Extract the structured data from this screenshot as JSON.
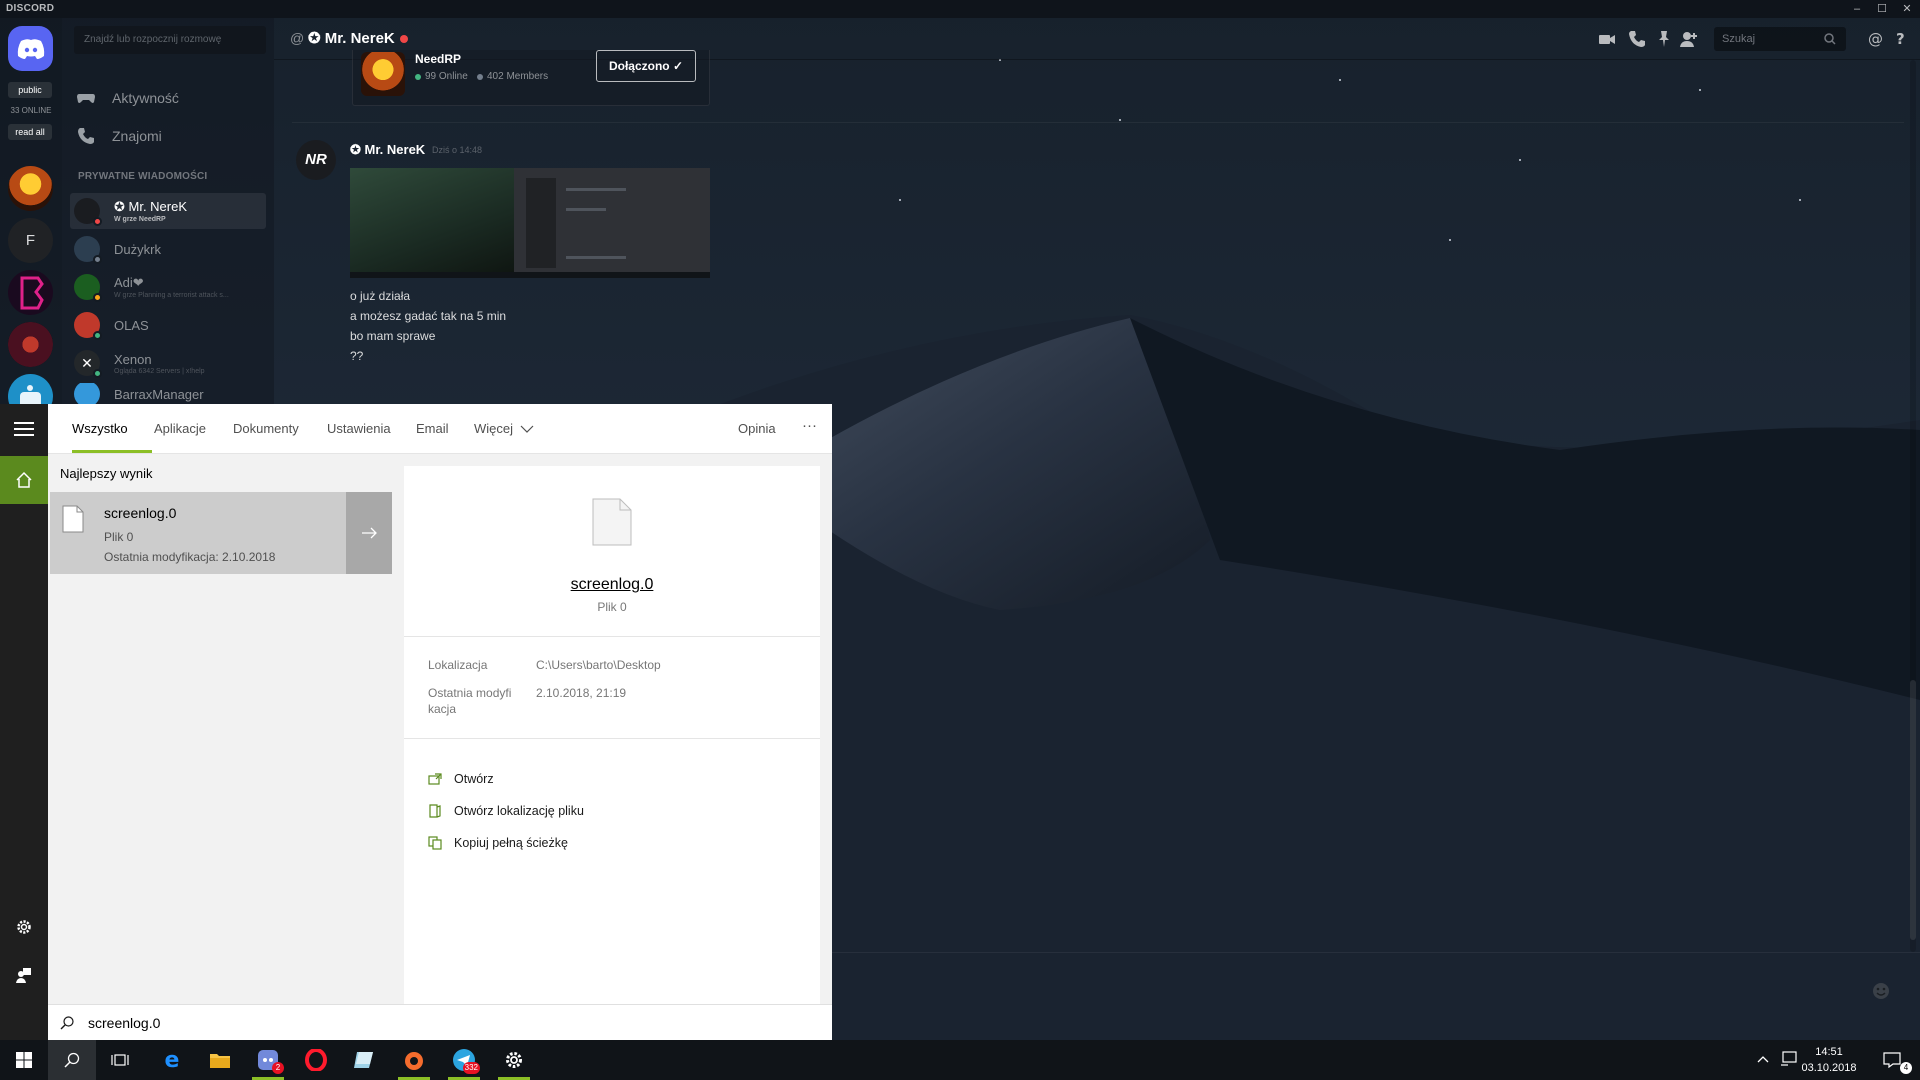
{
  "window": {
    "brand": "DISCORD",
    "controls": [
      "–",
      "☐",
      "✕"
    ]
  },
  "guilds": {
    "public_label": "public",
    "online_count": "33 ONLINE",
    "read_all": "read all",
    "server_letter": "F"
  },
  "dm_panel": {
    "search_placeholder": "Znajdź lub rozpocznij rozmowę",
    "nav": [
      {
        "label": "Aktywność",
        "icon": "gamepad-icon"
      },
      {
        "label": "Znajomi",
        "icon": "friends-icon"
      }
    ],
    "section_header": "PRYWATNE WIADOMOŚCI",
    "dms": [
      {
        "name": "✪ Mr. NereK",
        "sub": "W grze NeedRP",
        "status": "dnd"
      },
      {
        "name": "Dużykrk",
        "sub": "",
        "status": "offline"
      },
      {
        "name": "Adi❤",
        "sub": "W grze Planning a terrorist attack s...",
        "status": "idle"
      },
      {
        "name": "OLAS",
        "sub": "",
        "status": "online"
      },
      {
        "name": "Xenon",
        "sub": "Ogląda 6342 Servers | x!help",
        "status": "online"
      },
      {
        "name": "BarraxManager",
        "sub": "",
        "status": "online"
      }
    ]
  },
  "chat": {
    "at_symbol": "@",
    "channel_title": "✪ Mr. NereK",
    "search_placeholder": "Szukaj",
    "header_icons": [
      "video-icon",
      "phone-icon",
      "pin-icon",
      "add-friend-icon",
      "mention-icon",
      "help-icon"
    ],
    "invite": {
      "server_name": "NeedRP",
      "online": "99 Online",
      "members": "402 Members",
      "joined_label": "Dołączono ✓"
    },
    "message": {
      "author": "✪ Mr. NereK",
      "timestamp": "Dziś o 14:48",
      "avatar_text": "NR",
      "lines": [
        "o już działa",
        "a możesz gadać tak na 5 min",
        "bo mam sprawe",
        "??"
      ]
    }
  },
  "start_menu": {
    "tabs": [
      "Wszystko",
      "Aplikacje",
      "Dokumenty",
      "Ustawienia",
      "Email",
      "Więcej"
    ],
    "feedback": "Opinia",
    "more": "···",
    "best_label": "Najlepszy wynik",
    "best": {
      "name": "screenlog.0",
      "type": "Plik 0",
      "modified": "Ostatnia modyfikacja: 2.10.2018"
    },
    "detail": {
      "name": "screenlog.0",
      "type": "Plik 0",
      "location_label": "Lokalizacja",
      "location_value": "C:\\Users\\barto\\Desktop",
      "modified_label_1": "Ostatnia modyfi",
      "modified_label_2": "kacja",
      "modified_value": "2.10.2018, 21:19"
    },
    "actions": [
      "Otwórz",
      "Otwórz lokalizację pliku",
      "Kopiuj pełną ścieżkę"
    ],
    "search_query": "screenlog.0"
  },
  "taskbar": {
    "time": "14:51",
    "date": "03.10.2018",
    "badge_discord": "2",
    "badge_telegram": "332",
    "badge_notifications": "4"
  }
}
